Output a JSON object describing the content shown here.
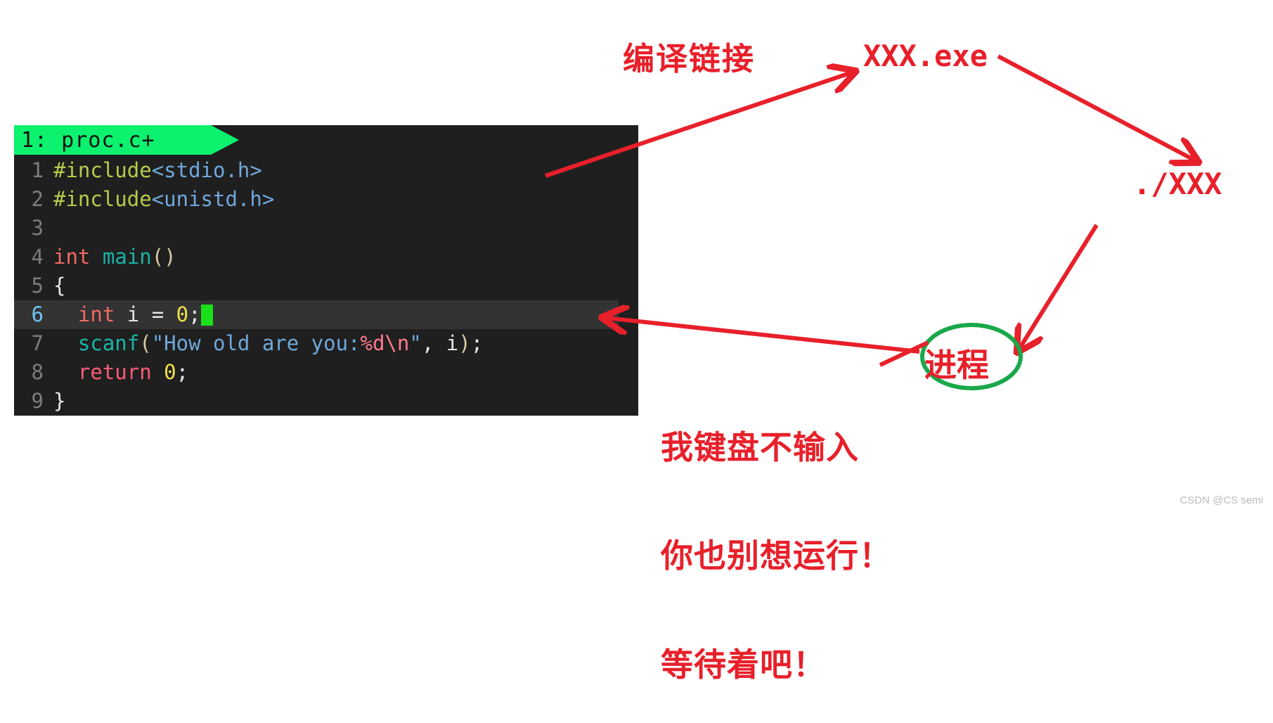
{
  "editor": {
    "tab_label": "1: proc.c+",
    "lines": [
      {
        "num": "1",
        "current": false,
        "tokens": [
          {
            "cls": "t-pp",
            "text": "#include"
          },
          {
            "cls": "t-hdr",
            "text": "<stdio.h>"
          }
        ]
      },
      {
        "num": "2",
        "current": false,
        "tokens": [
          {
            "cls": "t-pp",
            "text": "#include"
          },
          {
            "cls": "t-hdr",
            "text": "<unistd.h>"
          }
        ]
      },
      {
        "num": "3",
        "current": false,
        "tokens": [
          {
            "cls": "t-plain",
            "text": ""
          }
        ]
      },
      {
        "num": "4",
        "current": false,
        "tokens": [
          {
            "cls": "t-kw",
            "text": "int"
          },
          {
            "cls": "t-plain",
            "text": " "
          },
          {
            "cls": "t-fn",
            "text": "main"
          },
          {
            "cls": "t-paren",
            "text": "()"
          }
        ]
      },
      {
        "num": "5",
        "current": false,
        "tokens": [
          {
            "cls": "t-brace",
            "text": "{"
          }
        ]
      },
      {
        "num": "6",
        "current": true,
        "tokens": [
          {
            "cls": "t-plain",
            "text": "  "
          },
          {
            "cls": "t-kw",
            "text": "int"
          },
          {
            "cls": "t-plain",
            "text": " i "
          },
          {
            "cls": "t-plain",
            "text": "= "
          },
          {
            "cls": "t-num",
            "text": "0"
          },
          {
            "cls": "t-plain",
            "text": ";"
          }
        ]
      },
      {
        "num": "7",
        "current": false,
        "tokens": [
          {
            "cls": "t-plain",
            "text": "  "
          },
          {
            "cls": "t-fn",
            "text": "scanf"
          },
          {
            "cls": "t-paren",
            "text": "("
          },
          {
            "cls": "t-str",
            "text": "\"How old are you:"
          },
          {
            "cls": "t-esc",
            "text": "%d\\n"
          },
          {
            "cls": "t-str",
            "text": "\""
          },
          {
            "cls": "t-plain",
            "text": ", i"
          },
          {
            "cls": "t-paren",
            "text": ")"
          },
          {
            "cls": "t-plain",
            "text": ";"
          }
        ]
      },
      {
        "num": "8",
        "current": false,
        "tokens": [
          {
            "cls": "t-plain",
            "text": "  "
          },
          {
            "cls": "t-ret",
            "text": "return"
          },
          {
            "cls": "t-plain",
            "text": " "
          },
          {
            "cls": "t-num",
            "text": "0"
          },
          {
            "cls": "t-plain",
            "text": ";"
          }
        ]
      },
      {
        "num": "9",
        "current": false,
        "tokens": [
          {
            "cls": "t-brace",
            "text": "}"
          }
        ]
      }
    ]
  },
  "annotations": {
    "compile_link": "编译链接",
    "executable": "XXX.exe",
    "run_command": "./XXX",
    "process": "进程",
    "note_line1": "我键盘不输入",
    "note_line2": "你也别想运行！",
    "note_line3": "等待着吧！"
  },
  "colors": {
    "annotation_red": "#e8202a",
    "ellipse_green": "#1aa84a",
    "tab_green": "#0cf26f",
    "editor_background": "#1f1f1f",
    "current_line_background": "#333333",
    "cursor_green": "#19e019"
  },
  "watermark": "CSDN @CS semi"
}
